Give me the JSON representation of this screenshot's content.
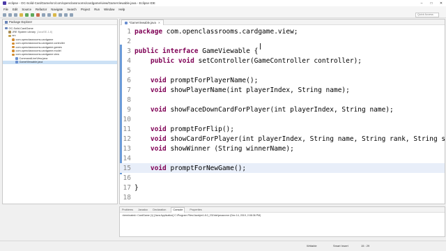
{
  "window": {
    "title": "eclipse - OC-Solid-CardGame/src/com/openclassrooms/cardgame/view/GameViewable.java - Eclipse IDE"
  },
  "menu": [
    "File",
    "Edit",
    "Source",
    "Refactor",
    "Navigate",
    "Search",
    "Project",
    "Run",
    "Window",
    "Help"
  ],
  "toolbar": {
    "quick_access": "Quick Access"
  },
  "explorer": {
    "title": "Package Explorer",
    "items": [
      {
        "label": "OC-Solid-CardGame",
        "extra": "",
        "icon": "project-icon"
      },
      {
        "label": "JRE System Library",
        "extra": "[JavaSE-1.8]",
        "icon": "library-icon"
      },
      {
        "label": "src",
        "extra": "",
        "icon": "source-folder-icon"
      },
      {
        "label": "com.openclassrooms.cardgame",
        "extra": "",
        "icon": "package-icon"
      },
      {
        "label": "com.openclassrooms.cardgame.controller",
        "extra": "",
        "icon": "package-icon"
      },
      {
        "label": "com.openclassrooms.cardgame.games",
        "extra": "",
        "icon": "package-icon"
      },
      {
        "label": "com.openclassrooms.cardgame.model",
        "extra": "",
        "icon": "package-icon"
      },
      {
        "label": "com.openclassrooms.cardgame.view",
        "extra": "",
        "icon": "package-icon"
      },
      {
        "label": "CommandLineView.java",
        "extra": "",
        "icon": "java-file-icon"
      },
      {
        "label": "GameViewable.java",
        "extra": "",
        "icon": "java-file-icon"
      }
    ]
  },
  "editor": {
    "tab_label": "*GameViewable.java",
    "lines": [
      {
        "n": "1",
        "kw": "package",
        "rest": " com.openclassrooms.cardgame.view;"
      },
      {
        "n": "2",
        "kw": "",
        "rest": ""
      },
      {
        "n": "3",
        "kw": "public interface",
        "rest": " GameViewable {"
      },
      {
        "n": "4",
        "kw": "    public void",
        "rest": " setController(GameController controller);"
      },
      {
        "n": "5",
        "kw": "",
        "rest": ""
      },
      {
        "n": "6",
        "kw": "    void",
        "rest": " promptForPlayerName();"
      },
      {
        "n": "7",
        "kw": "    void",
        "rest": " showPlayerName(int playerIndex, String name);"
      },
      {
        "n": "8",
        "kw": "",
        "rest": ""
      },
      {
        "n": "9",
        "kw": "    void",
        "rest": " showFaceDownCardForPlayer(int playerIndex, String name);"
      },
      {
        "n": "10",
        "kw": "",
        "rest": ""
      },
      {
        "n": "11",
        "kw": "    void",
        "rest": " promptForFlip();"
      },
      {
        "n": "12",
        "kw": "    void",
        "rest": " showCardForPlayer(int playerIndex, String name, String rank, String suit);"
      },
      {
        "n": "13",
        "kw": "    void",
        "rest": " showWinner (String winnerName);"
      },
      {
        "n": "14",
        "kw": "",
        "rest": ""
      },
      {
        "n": "15",
        "kw": "    void",
        "rest": " promptForNewGame();"
      },
      {
        "n": "16",
        "kw": "",
        "rest": ""
      },
      {
        "n": "17",
        "kw": "",
        "rest": "}"
      },
      {
        "n": "18",
        "kw": "",
        "rest": ""
      }
    ]
  },
  "bottom_panel": {
    "tabs": [
      "Problems",
      "Javadoc",
      "Declaration",
      "Console",
      "Properties"
    ],
    "active_tab": "Console",
    "console_text": "<terminated> CardGame (1) [Java Application] C:\\Program Files\\Java\\jre1.8.0_231\\bin\\javaw.exe (Dec 14, 2019, 2:08:36 PM)"
  },
  "status": {
    "writable": "Writable",
    "insert_mode": "Smart Insert",
    "position": "15 : 29"
  }
}
